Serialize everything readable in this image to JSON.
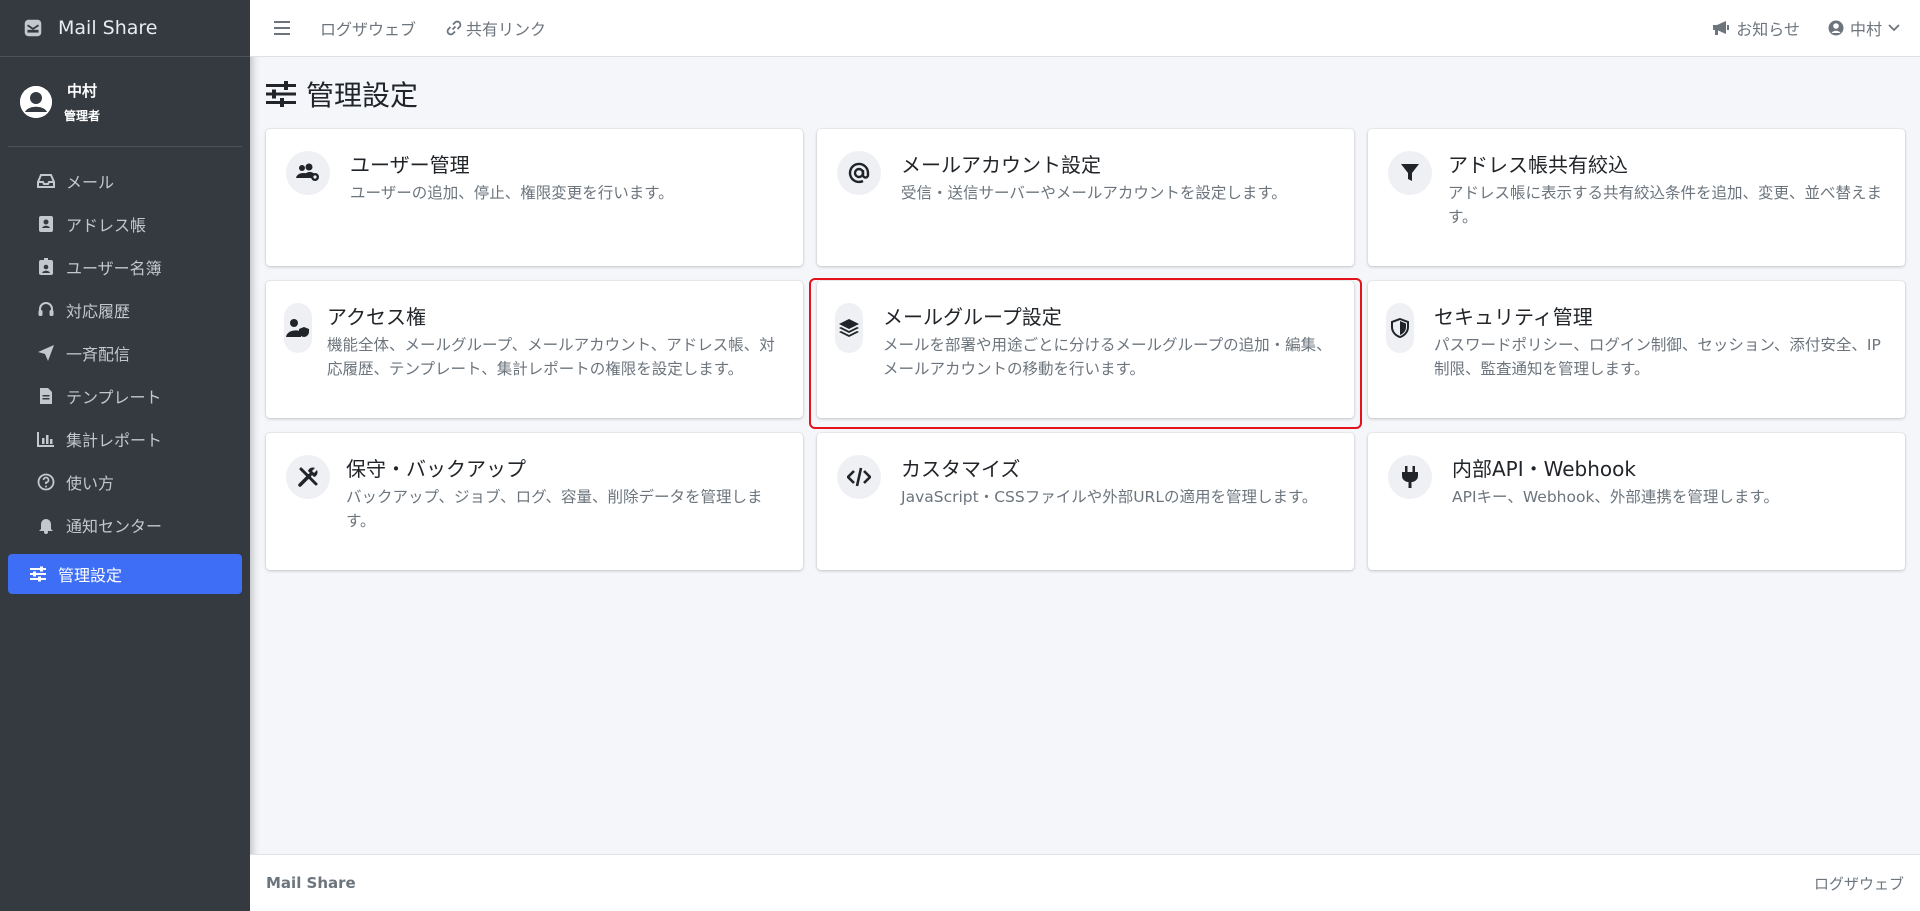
{
  "brand": {
    "name": "Mail Share"
  },
  "user": {
    "name": "中村",
    "role": "管理者"
  },
  "sidebar": {
    "items": [
      {
        "label": "メール",
        "icon": "inbox-icon"
      },
      {
        "label": "アドレス帳",
        "icon": "address-book-icon"
      },
      {
        "label": "ユーザー名簿",
        "icon": "id-badge-icon"
      },
      {
        "label": "対応履歴",
        "icon": "headset-icon"
      },
      {
        "label": "一斉配信",
        "icon": "paper-plane-icon"
      },
      {
        "label": "テンプレート",
        "icon": "file-icon"
      },
      {
        "label": "集計レポート",
        "icon": "bar-chart-icon"
      },
      {
        "label": "使い方",
        "icon": "question-circle-icon"
      },
      {
        "label": "通知センター",
        "icon": "bell-icon"
      },
      {
        "label": "管理設定",
        "icon": "sliders-icon",
        "active": true
      }
    ]
  },
  "topbar": {
    "link1": "ログザウェブ",
    "link2": "共有リンク",
    "notice": "お知らせ",
    "user": "中村"
  },
  "page": {
    "title": "管理設定"
  },
  "cards": [
    {
      "title": "ユーザー管理",
      "desc": "ユーザーの追加、停止、権限変更を行います。",
      "icon": "users-gear-icon"
    },
    {
      "title": "メールアカウント設定",
      "desc": "受信・送信サーバーやメールアカウントを設定します。",
      "icon": "at-icon"
    },
    {
      "title": "アドレス帳共有絞込",
      "desc": "アドレス帳に表示する共有絞込条件を追加、変更、並べ替えます。",
      "icon": "filter-icon"
    },
    {
      "title": "アクセス権",
      "desc": "機能全体、メールグループ、メールアカウント、アドレス帳、対応履歴、テンプレート、集計レポートの権限を設定します。",
      "icon": "user-shield-icon"
    },
    {
      "title": "メールグループ設定",
      "desc": "メールを部署や用途ごとに分けるメールグループの追加・編集、メールアカウントの移動を行います。",
      "icon": "layers-icon"
    },
    {
      "title": "セキュリティ管理",
      "desc": "パスワードポリシー、ログイン制御、セッション、添付安全、IP制限、監査通知を管理します。",
      "icon": "shield-icon"
    },
    {
      "title": "保守・バックアップ",
      "desc": "バックアップ、ジョブ、ログ、容量、削除データを管理します。",
      "icon": "tools-icon"
    },
    {
      "title": "カスタマイズ",
      "desc": "JavaScript・CSSファイルや外部URLの適用を管理します。",
      "icon": "code-icon"
    },
    {
      "title": "内部API・Webhook",
      "desc": "APIキー、Webhook、外部連携を管理します。",
      "icon": "plug-icon"
    }
  ],
  "footer": {
    "left": "Mail Share",
    "right": "ログザウェブ"
  }
}
